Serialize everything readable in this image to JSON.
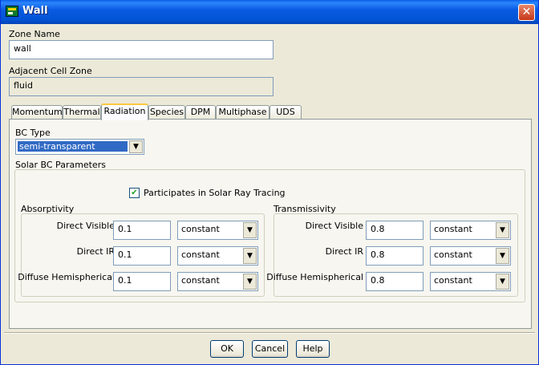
{
  "window": {
    "title": "Wall",
    "close_glyph": "✕"
  },
  "zone_name": {
    "label": "Zone Name",
    "value": "wall"
  },
  "adjacent_cell_zone": {
    "label": "Adjacent Cell Zone",
    "value": "fluid"
  },
  "tabs": [
    {
      "label": "Momentum"
    },
    {
      "label": "Thermal"
    },
    {
      "label": "Radiation"
    },
    {
      "label": "Species"
    },
    {
      "label": "DPM"
    },
    {
      "label": "Multiphase"
    },
    {
      "label": "UDS"
    }
  ],
  "active_tab": "Radiation",
  "radiation": {
    "bc_type_label": "BC Type",
    "bc_type_value": "semi-transparent",
    "solar_group_label": "Solar BC Parameters",
    "participates": {
      "label": "Participates in Solar Ray Tracing",
      "checked": true
    },
    "absorptivity": {
      "label": "Absorptivity",
      "rows": [
        {
          "label": "Direct Visible",
          "value": "0.1",
          "method": "constant"
        },
        {
          "label": "Direct IR",
          "value": "0.1",
          "method": "constant"
        },
        {
          "label": "Diffuse Hemispherical",
          "value": "0.1",
          "method": "constant"
        }
      ]
    },
    "transmissivity": {
      "label": "Transmissivity",
      "rows": [
        {
          "label": "Direct Visible",
          "value": "0.8",
          "method": "constant"
        },
        {
          "label": "Direct IR",
          "value": "0.8",
          "method": "constant"
        },
        {
          "label": "Diffuse Hemispherical",
          "value": "0.8",
          "method": "constant"
        }
      ]
    }
  },
  "buttons": {
    "ok": "OK",
    "cancel": "Cancel",
    "help": "Help"
  },
  "icons": {
    "app": "fluent-app-icon",
    "checkbox_mark": "✔",
    "dropdown": "▼"
  }
}
